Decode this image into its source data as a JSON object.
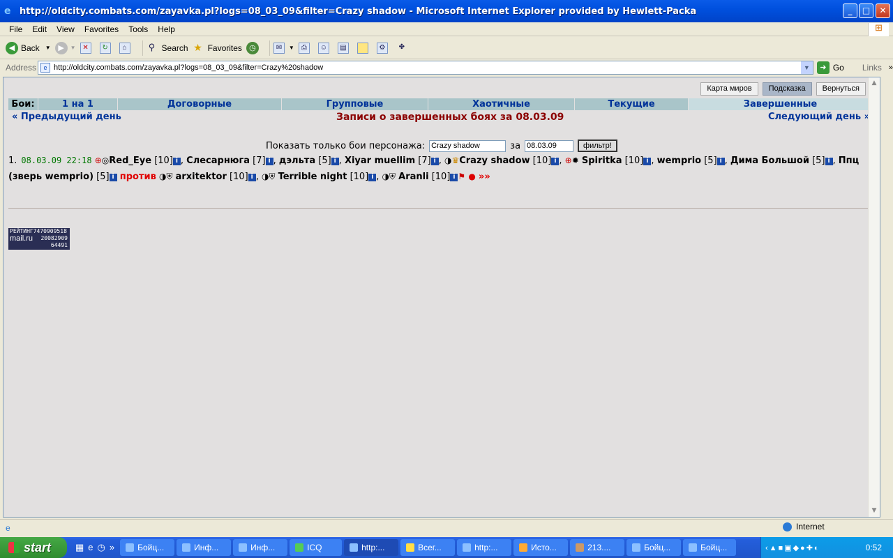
{
  "window": {
    "title": "http://oldcity.combats.com/zayavka.pl?logs=08_03_09&filter=Crazy shadow - Microsoft Internet Explorer provided by Hewlett-Packa"
  },
  "menu": [
    "File",
    "Edit",
    "View",
    "Favorites",
    "Tools",
    "Help"
  ],
  "toolbar": {
    "back": "Back",
    "search": "Search",
    "favorites": "Favorites"
  },
  "address": {
    "label": "Address",
    "url": "http://oldcity.combats.com/zayavka.pl?logs=08_03_09&filter=Crazy%20shadow",
    "go": "Go",
    "links": "Links"
  },
  "page": {
    "top_buttons": [
      "Карта миров",
      "Подсказка",
      "Вернуться"
    ],
    "tabs": [
      "Бои:",
      "1 на 1",
      "Договорные",
      "Групповые",
      "Хаотичные",
      "Текущие",
      "Завершенные"
    ],
    "prev_day": "« Предыдущий день",
    "next_day": "Следующий день »",
    "heading": "Записи о завершенных боях за 08.03.09",
    "filter_label": "Показать только бои персонажа:",
    "filter_value": "Crazy shadow",
    "date_label": "за",
    "date_value": "08.03.09",
    "filter_button": "фильтр!",
    "battle": {
      "num": "1.",
      "datetime": "08.03.09 22:18",
      "team1": [
        {
          "name": "Red_Eye",
          "level": "[10]"
        },
        {
          "name": "Слесарнюга",
          "level": "[7]"
        },
        {
          "name": "дэльта",
          "level": "[5]"
        },
        {
          "name": "Xiyar muellim",
          "level": "[7]"
        },
        {
          "name": "Crazy shadow",
          "level": "[10]"
        },
        {
          "name": "Spiritka",
          "level": "[10]"
        },
        {
          "name": "wemprio",
          "level": "[5]"
        },
        {
          "name": "Дима Большой",
          "level": "[5]"
        },
        {
          "name": "Ппц (зверь wemprio)",
          "level": "[5]"
        }
      ],
      "versus": "против",
      "team2": [
        {
          "name": "arxitektor",
          "level": "[10]"
        },
        {
          "name": "Terrible night",
          "level": "[10]"
        },
        {
          "name": "Aranli",
          "level": "[10]"
        }
      ],
      "more": "»»"
    },
    "counter": {
      "line1": "РЕЙТИНГ7470909518",
      "line2": "mail.ru",
      "line3": "20082909",
      "line4": "64491"
    }
  },
  "status": {
    "zone": "Internet"
  },
  "taskbar": {
    "start": "start",
    "items": [
      "Бойц...",
      "Инф...",
      "Инф...",
      "ICQ",
      "http:...",
      "Всег...",
      "http:...",
      "Исто...",
      "213....",
      "Бойц...",
      "Бойц..."
    ],
    "time": "0:52"
  }
}
